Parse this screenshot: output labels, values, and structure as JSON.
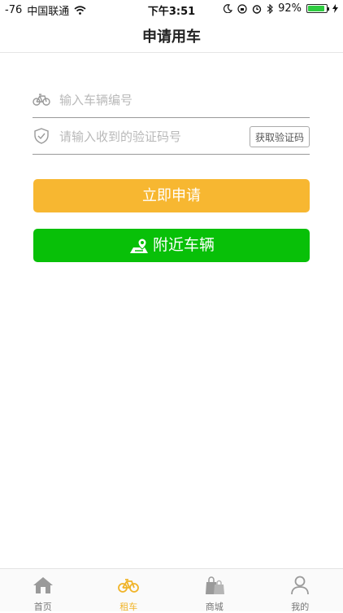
{
  "status_bar": {
    "signal": "-76",
    "carrier": "中国联通",
    "time": "下午3:51",
    "battery_percent_text": "92%",
    "battery_level": 0.92
  },
  "nav": {
    "title": "申请用车"
  },
  "form": {
    "vehicle_placeholder": "输入车辆编号",
    "code_placeholder": "请输入收到的验证码号",
    "get_code_label": "获取验证码"
  },
  "buttons": {
    "apply_label": "立即申请",
    "nearby_label": "附近车辆"
  },
  "tabs": [
    {
      "label": "首页",
      "icon": "home-icon"
    },
    {
      "label": "租车",
      "icon": "bicycle-icon"
    },
    {
      "label": "商城",
      "icon": "shopping-bag-icon"
    },
    {
      "label": "我的",
      "icon": "user-icon"
    }
  ],
  "colors": {
    "accent_yellow": "#f7b731",
    "accent_green": "#08c008",
    "active_tab": "#f0b429"
  }
}
